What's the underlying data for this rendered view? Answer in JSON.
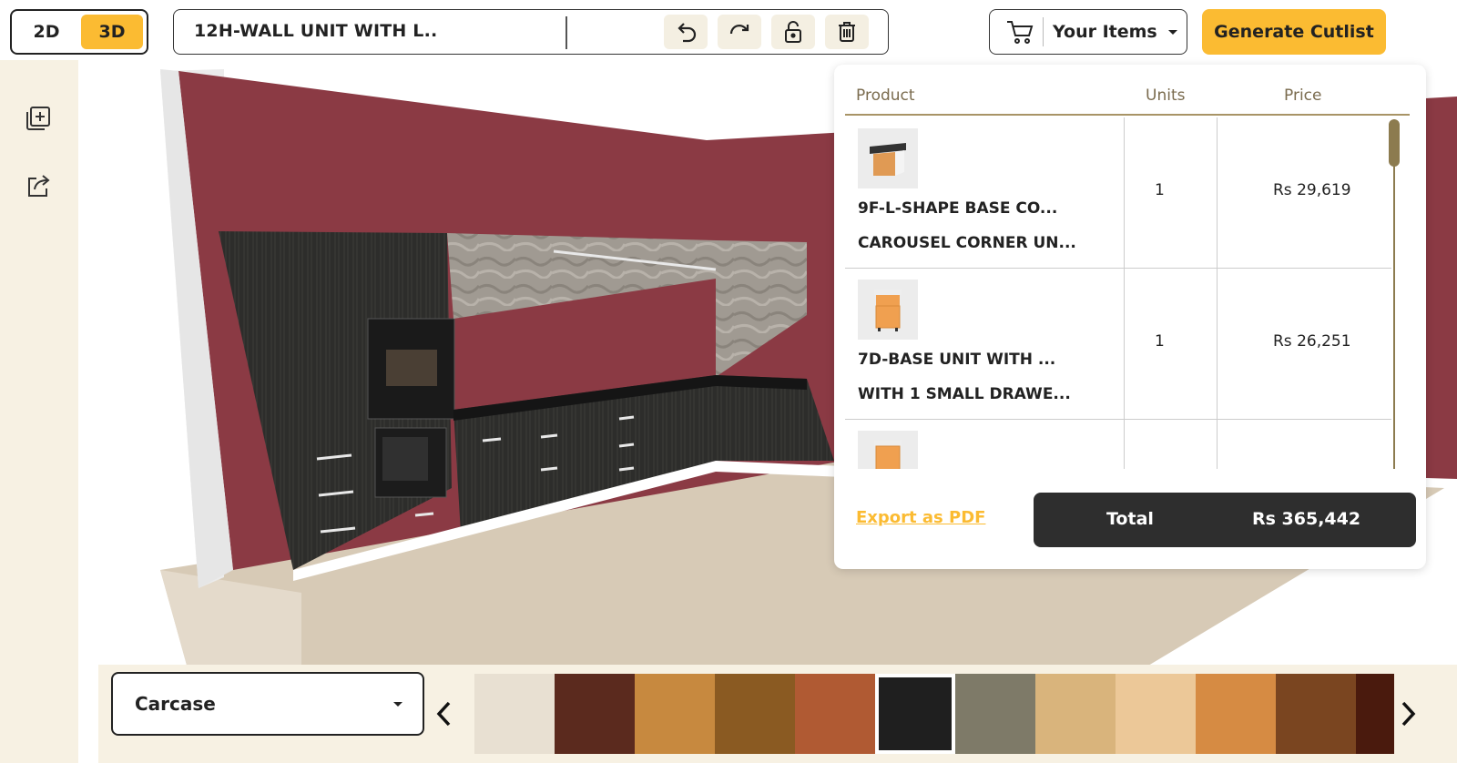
{
  "view_toggle": {
    "options": [
      "2D",
      "3D"
    ],
    "active": "3D"
  },
  "toolbar": {
    "item_title": "12H-WALL UNIT WITH L..",
    "undo_icon": "undo-icon",
    "redo_icon": "redo-icon",
    "lock_icon": "lock-icon",
    "delete_icon": "trash-icon"
  },
  "header": {
    "your_items_label": "Your Items",
    "generate_label": "Generate Cutlist"
  },
  "left_rail": {
    "icons": [
      "add-item-icon",
      "share-icon"
    ]
  },
  "cart": {
    "columns": {
      "product": "Product",
      "units": "Units",
      "price": "Price"
    },
    "rows": [
      {
        "name1": "9F-L-SHAPE BASE CO...",
        "name2": "CAROUSEL CORNER UN...",
        "units": "1",
        "price": "Rs 29,619",
        "thumb": "l-shape-base-thumb"
      },
      {
        "name1": "7D-BASE UNIT WITH ...",
        "name2": "WITH 1 SMALL DRAWE...",
        "units": "1",
        "price": "Rs 26,251",
        "thumb": "base-unit-thumb"
      },
      {
        "name1": "",
        "name2": "",
        "units": "",
        "price": "",
        "thumb": "base-unit-thumb"
      }
    ],
    "export_label": "Export as PDF",
    "total_label": "Total",
    "total_value": "Rs 365,442"
  },
  "bottom": {
    "part_select": {
      "selected": "Carcase"
    },
    "swatches": [
      "#e8e0d2",
      "#5b2a1e",
      "#c7893f",
      "#8a5a22",
      "#b05a33",
      "#1f1f1f",
      "#7e7a68",
      "#d9b47c",
      "#ecc898",
      "#d68b43",
      "#7a4520",
      "#4a1a0d"
    ],
    "selected_swatch_index": 5
  },
  "colors": {
    "accent": "#fbbb32",
    "dark": "#2e2e2e",
    "wall": "#8b3a44",
    "cabinet": "#2b2b2b",
    "floor": "#d7cab6"
  }
}
